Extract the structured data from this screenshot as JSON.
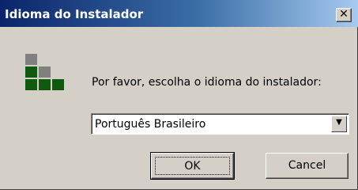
{
  "window": {
    "title": "Idioma do Instalador",
    "close_glyph": "✕"
  },
  "logo": {
    "icon": "installer-logo-icon",
    "colors": {
      "gray": "#808080",
      "green": "#0f5a0f"
    }
  },
  "prompt": "Por favor, escolha o idioma do instalador:",
  "language_select": {
    "selected": "Português Brasileiro",
    "arrow_glyph": "▼"
  },
  "buttons": {
    "ok_label": "OK",
    "cancel_label": "Cancel"
  },
  "colors": {
    "title_gradient_start": "#0a246a",
    "title_gradient_end": "#a6caf0",
    "dialog_face": "#d4d0c8"
  }
}
